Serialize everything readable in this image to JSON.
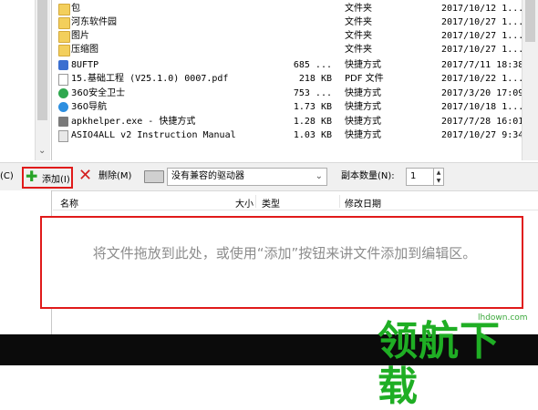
{
  "files": [
    {
      "name": "包",
      "size": "",
      "type": "文件夹",
      "date": "2017/10/12 1...",
      "icon": "folder-icon"
    },
    {
      "name": "河东软件园",
      "size": "",
      "type": "文件夹",
      "date": "2017/10/27 1...",
      "icon": "folder-icon"
    },
    {
      "name": "图片",
      "size": "",
      "type": "文件夹",
      "date": "2017/10/27 1...",
      "icon": "folder-icon"
    },
    {
      "name": "压缩图",
      "size": "",
      "type": "文件夹",
      "date": "2017/10/27 1...",
      "icon": "folder-icon"
    },
    {
      "name": "8UFTP",
      "size": "685 ...",
      "type": "快捷方式",
      "date": "2017/7/11 18:38",
      "icon": "app-icon"
    },
    {
      "name": "15.基础工程 (V25.1.0) 0007.pdf",
      "size": "218 KB",
      "type": "PDF 文件",
      "date": "2017/10/22 1...",
      "icon": "pdf-icon"
    },
    {
      "name": "360安全卫士",
      "size": "753 ...",
      "type": "快捷方式",
      "date": "2017/3/20 17:09",
      "icon": "shield-icon"
    },
    {
      "name": "360导航",
      "size": "1.73 KB",
      "type": "快捷方式",
      "date": "2017/10/18 1...",
      "icon": "globe-icon"
    },
    {
      "name": "apkhelper.exe - 快捷方式",
      "size": "1.28 KB",
      "type": "快捷方式",
      "date": "2017/7/28 16:01",
      "icon": "exe-icon"
    },
    {
      "name": "ASIO4ALL v2 Instruction Manual",
      "size": "1.03 KB",
      "type": "快捷方式",
      "date": "2017/10/27 9:34",
      "icon": "doc-icon"
    }
  ],
  "toolbar": {
    "left_clip": "(C)",
    "add_label": "添加(I)",
    "delete_label": "删除(M)",
    "drive_value": "没有兼容的驱动器",
    "copies_label": "副本数量(N):",
    "copies_value": "1"
  },
  "list_header": {
    "name": "名称",
    "size": "大小",
    "type": "类型",
    "modified": "修改日期"
  },
  "drop_hint": "将文件拖放到此处，或使用“添加”按钮来讲文件添加到编辑区。",
  "watermark": {
    "logo": "领航下载",
    "site": "lhdown.com"
  },
  "colors": {
    "highlight_red": "#e01a1a",
    "add_green": "#27a327",
    "watermark_green": "#1fae24"
  }
}
